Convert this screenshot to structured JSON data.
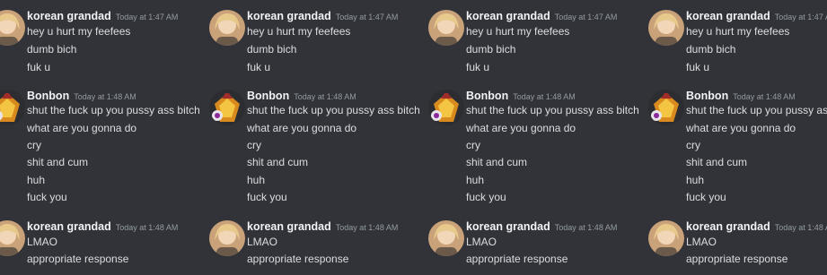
{
  "groups": [
    {
      "username": "korean grandad",
      "timestamp": "Today at 1:47 AM",
      "avatar_icon": "user-avatar-blonde",
      "messages": [
        "hey u hurt my feefees",
        "dumb bich",
        "fuk u"
      ]
    },
    {
      "username": "Bonbon",
      "timestamp": "Today at 1:48 AM",
      "avatar_icon": "user-avatar-bonbon-emblem",
      "messages": [
        "shut the fuck up you pussy ass bitch",
        "what are you gonna do",
        "cry",
        "shit and cum",
        "huh",
        "fuck you"
      ]
    },
    {
      "username": "korean grandad",
      "timestamp": "Today at 1:48 AM",
      "avatar_icon": "user-avatar-blonde",
      "messages": [
        "LMAO",
        "appropriate response"
      ]
    }
  ],
  "colors": {
    "background": "#313338",
    "username": "#f2f3f5",
    "timestamp": "#949ba4",
    "message": "#dbdee1"
  }
}
